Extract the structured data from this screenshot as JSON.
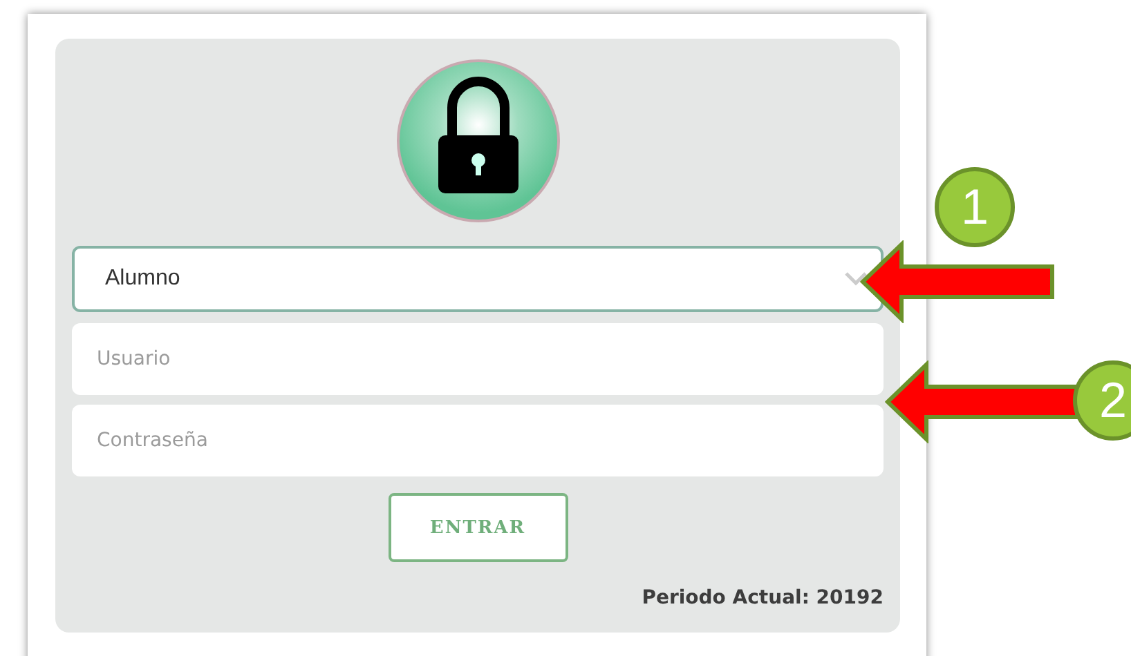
{
  "login": {
    "role_select": {
      "value": "Alumno"
    },
    "fields": [
      {
        "placeholder": "Usuario"
      },
      {
        "placeholder": "Contraseña"
      }
    ],
    "submit": "ENTRAR",
    "period": "Periodo Actual: 20192"
  },
  "annotations": [
    {
      "label": "1"
    },
    {
      "label": "2"
    }
  ]
}
